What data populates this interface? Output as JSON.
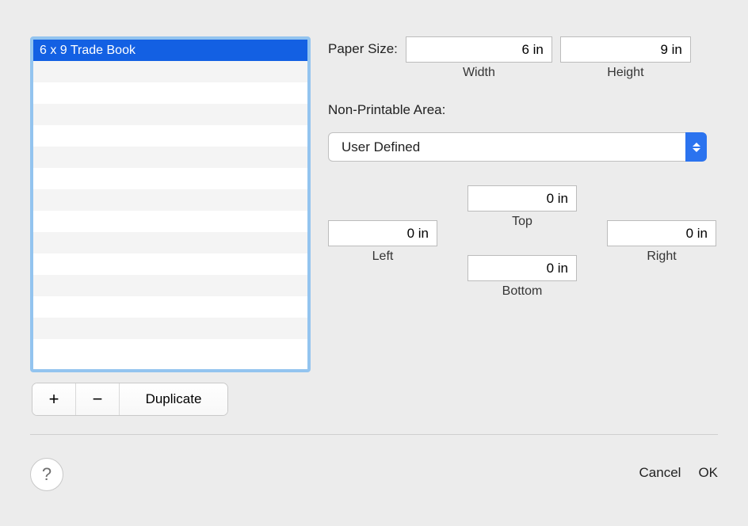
{
  "paperSizes": {
    "items": [
      {
        "name": "6 x 9 Trade Book",
        "selected": true
      }
    ],
    "visibleRowCount": 15
  },
  "listControls": {
    "add": "+",
    "remove": "−",
    "duplicate": "Duplicate"
  },
  "paperSizeSection": {
    "title": "Paper Size:",
    "width": {
      "value": "6 in",
      "label": "Width"
    },
    "height": {
      "value": "9 in",
      "label": "Height"
    }
  },
  "nonPrintable": {
    "title": "Non-Printable Area:",
    "mode": "User Defined",
    "top": {
      "value": "0 in",
      "label": "Top"
    },
    "bottom": {
      "value": "0 in",
      "label": "Bottom"
    },
    "left": {
      "value": "0 in",
      "label": "Left"
    },
    "right": {
      "value": "0 in",
      "label": "Right"
    }
  },
  "footer": {
    "help": "?",
    "cancel": "Cancel",
    "ok": "OK"
  }
}
